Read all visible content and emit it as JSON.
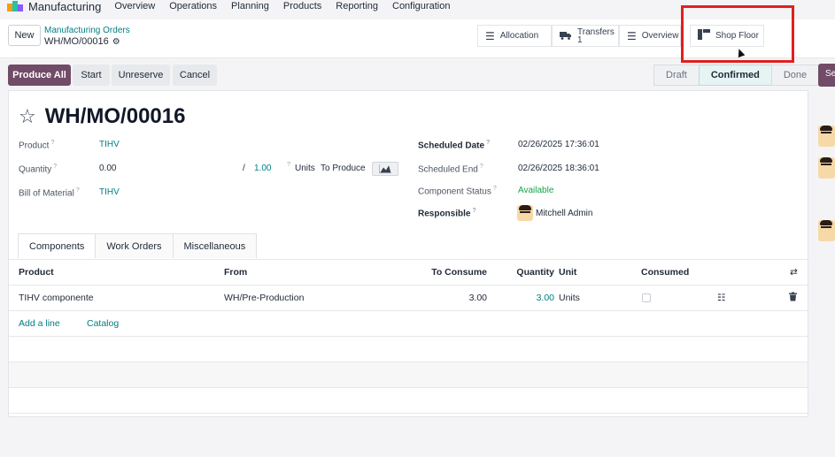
{
  "nav": {
    "app_name": "Manufacturing",
    "menu": [
      "Overview",
      "Operations",
      "Planning",
      "Products",
      "Reporting",
      "Configuration"
    ]
  },
  "control_panel": {
    "new_label": "New",
    "breadcrumb_parent": "Manufacturing Orders",
    "breadcrumb_current": "WH/MO/00016",
    "smart_buttons": {
      "allocation": "Allocation",
      "transfers_label": "Transfers",
      "transfers_count": "1",
      "overview": "Overview",
      "shop_floor": "Shop Floor"
    }
  },
  "actions": {
    "produce_all": "Produce All",
    "start": "Start",
    "unreserve": "Unreserve",
    "cancel": "Cancel"
  },
  "status": {
    "draft": "Draft",
    "confirmed": "Confirmed",
    "done": "Done",
    "current": "Confirmed"
  },
  "side_tag": "Se",
  "form": {
    "title": "WH/MO/00016",
    "product_label": "Product",
    "product_value": "TIHV",
    "quantity_label": "Quantity",
    "quantity_value": "0.00",
    "quantity_sep": "/",
    "quantity_target": "1.00",
    "units_label": "Units",
    "to_produce_label": "To Produce",
    "bom_label": "Bill of Material",
    "bom_value": "TIHV",
    "scheduled_date_label": "Scheduled Date",
    "scheduled_date_value": "02/26/2025 17:36:01",
    "scheduled_end_label": "Scheduled End",
    "scheduled_end_value": "02/26/2025 18:36:01",
    "component_status_label": "Component Status",
    "component_status_value": "Available",
    "responsible_label": "Responsible",
    "responsible_value": "Mitchell Admin",
    "help_mark": "?"
  },
  "tabs": [
    "Components",
    "Work Orders",
    "Miscellaneous"
  ],
  "table": {
    "headers": {
      "product": "Product",
      "from": "From",
      "to_consume": "To Consume",
      "quantity": "Quantity",
      "unit": "Unit",
      "consumed": "Consumed"
    },
    "rows": [
      {
        "product": "TIHV componente",
        "from": "WH/Pre-Production",
        "to_consume": "3.00",
        "quantity": "3.00",
        "unit": "Units"
      }
    ],
    "add_line": "Add a line",
    "catalog": "Catalog"
  },
  "colors": {
    "primary": "#714b67",
    "link": "#017e84",
    "success": "#16a34a",
    "highlight": "#e02020"
  }
}
